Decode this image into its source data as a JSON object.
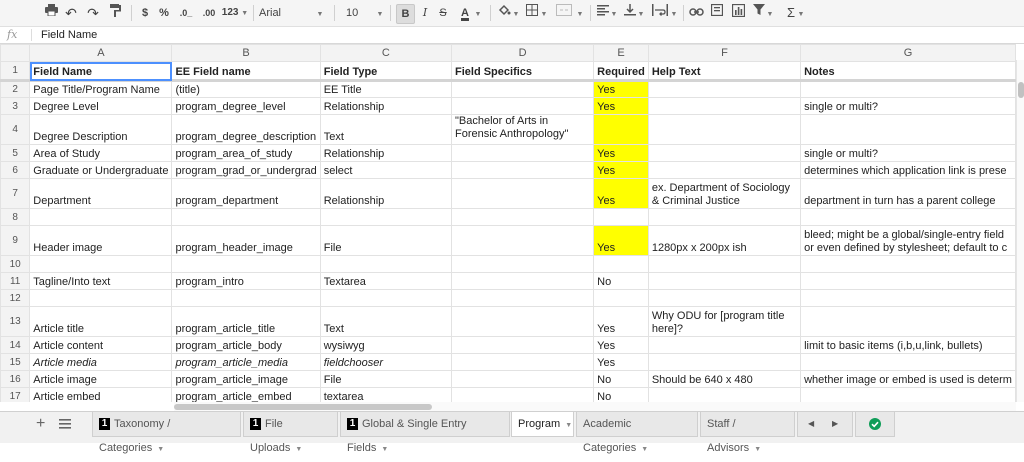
{
  "toolbar": {
    "font": "Arial",
    "size": "10",
    "currency": "$",
    "percent": "%",
    "dec_less": ".0_",
    "dec_more": ".00",
    "format_more": "123",
    "bold": "B",
    "italic": "I",
    "strike": "S",
    "text_color": "A",
    "sigma": "Σ"
  },
  "formula_bar": {
    "fx": "fx",
    "value": "Field Name"
  },
  "columns": [
    "A",
    "B",
    "C",
    "D",
    "E",
    "F",
    "G"
  ],
  "rows": [
    {
      "n": "1",
      "a": "Field Name",
      "b": "EE Field name",
      "c": "Field Type",
      "d": "Field Specifics",
      "e": "Required",
      "f": "Help Text",
      "g": "Notes"
    },
    {
      "n": "2",
      "a": "Page Title/Program Name",
      "b": "(title)",
      "c": "EE Title",
      "d": "",
      "e": "Yes",
      "f": "",
      "g": ""
    },
    {
      "n": "3",
      "a": "Degree Level",
      "b": "program_degree_level",
      "c": "Relationship",
      "d": "",
      "e": "Yes",
      "f": "",
      "g": "single or multi?"
    },
    {
      "n": "4",
      "a": "Degree Description",
      "b": "program_degree_description",
      "c": "Text",
      "d": "\"Bachelor of Arts in Forensic Anthropology\"",
      "e": "",
      "f": "",
      "g": ""
    },
    {
      "n": "5",
      "a": "Area of Study",
      "b": "program_area_of_study",
      "c": "Relationship",
      "d": "",
      "e": "Yes",
      "f": "",
      "g": "single or multi?"
    },
    {
      "n": "6",
      "a": "Graduate or Undergraduate",
      "b": "program_grad_or_undergrad",
      "c": "select",
      "d": "",
      "e": "Yes",
      "f": "",
      "g": "determines which application link is prese"
    },
    {
      "n": "7",
      "a": "Department",
      "b": "program_department",
      "c": "Relationship",
      "d": "",
      "e": "Yes",
      "f": "ex. Department of Sociology & Criminal Justice",
      "g": "department in turn has a parent college"
    },
    {
      "n": "8",
      "a": "",
      "b": "",
      "c": "",
      "d": "",
      "e": "",
      "f": "",
      "g": ""
    },
    {
      "n": "9",
      "a": "Header image",
      "b": "program_header_image",
      "c": "File",
      "d": "",
      "e": "Yes",
      "f": "1280px x 200px ish",
      "g": "bleed; might be a global/single-entry field or even defined by stylesheet; default to c"
    },
    {
      "n": "10",
      "a": "",
      "b": "",
      "c": "",
      "d": "",
      "e": "",
      "f": "",
      "g": ""
    },
    {
      "n": "11",
      "a": "Tagline/Into text",
      "b": "program_intro",
      "c": "Textarea",
      "d": "",
      "e": "No",
      "f": "",
      "g": ""
    },
    {
      "n": "12",
      "a": "",
      "b": "",
      "c": "",
      "d": "",
      "e": "",
      "f": "",
      "g": ""
    },
    {
      "n": "13",
      "a": "Article title",
      "b": "program_article_title",
      "c": "Text",
      "d": "",
      "e": "Yes",
      "f": "Why ODU for [program title here]?",
      "g": ""
    },
    {
      "n": "14",
      "a": "Article content",
      "b": "program_article_body",
      "c": "wysiwyg",
      "d": "",
      "e": "Yes",
      "f": "",
      "g": "limit to basic items (i,b,u,link, bullets)"
    },
    {
      "n": "15",
      "a": "Article media",
      "b": "program_article_media",
      "c": "fieldchooser",
      "d": "",
      "e": "Yes",
      "f": "",
      "g": ""
    },
    {
      "n": "16",
      "a": "Article image",
      "b": "program_article_image",
      "c": "File",
      "d": "",
      "e": "No",
      "f": "Should be 640 x 480",
      "g": "whether image or embed is used is determ"
    },
    {
      "n": "17",
      "a": "Article embed",
      "b": "program_article_embed",
      "c": "textarea",
      "d": "",
      "e": "No",
      "f": "",
      "g": ""
    }
  ],
  "sheet_tabs": [
    {
      "label": "Taxonomy / Categories",
      "badge": "1"
    },
    {
      "label": "File Uploads",
      "badge": "1"
    },
    {
      "label": "Global & Single Entry Fields",
      "badge": "1"
    },
    {
      "label": "Program",
      "badge": ""
    },
    {
      "label": "Academic Categories",
      "badge": ""
    },
    {
      "label": "Staff / Advisors",
      "badge": ""
    }
  ],
  "colors": {
    "required_highlight": "#ffff00",
    "selection": "#4d90fe",
    "sync_ok": "#0f9d58"
  }
}
